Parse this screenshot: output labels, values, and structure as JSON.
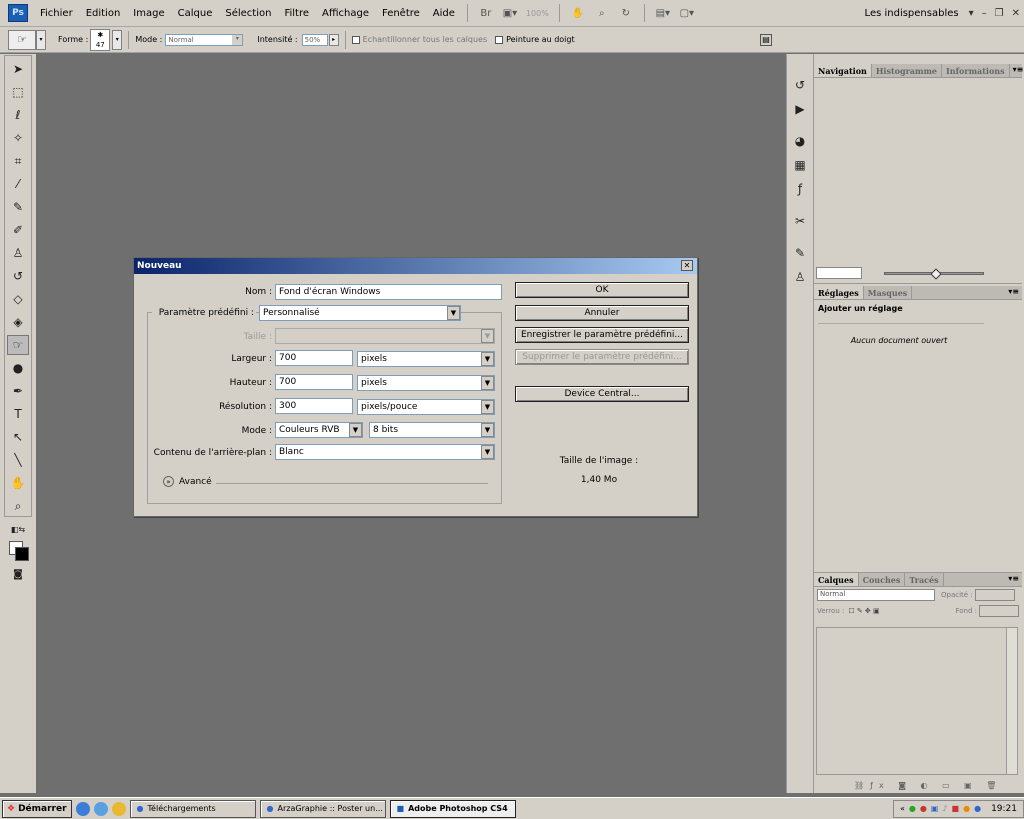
{
  "menubar": {
    "logo": "Ps",
    "items": [
      "Fichier",
      "Edition",
      "Image",
      "Calque",
      "Sélection",
      "Filtre",
      "Affichage",
      "Fenêtre",
      "Aide"
    ],
    "zoom": "100%",
    "workspace": "Les indispensables"
  },
  "options": {
    "forme_label": "Forme :",
    "brush_size": "47",
    "mode_label": "Mode :",
    "mode_value": "Normal",
    "intensite_label": "Intensité :",
    "intensite_value": "50%",
    "sample_all_label": "Echantillonner tous les calques",
    "finger_paint_label": "Peinture au doigt"
  },
  "panels": {
    "nav_tabs": [
      "Navigation",
      "Histogramme",
      "Informations"
    ],
    "adj_tabs": [
      "Réglages",
      "Masques"
    ],
    "adj_title": "Ajouter un réglage",
    "adj_empty": "Aucun document ouvert",
    "layer_tabs": [
      "Calques",
      "Couches",
      "Tracés"
    ],
    "blend_mode": "Normal",
    "opacity_label": "Opacité :",
    "lock_label": "Verrou :",
    "fill_label": "Fond :"
  },
  "dialog": {
    "title": "Nouveau",
    "nom_label": "Nom :",
    "nom_value": "Fond d'écran Windows",
    "preset_label": "Paramètre prédéfini :",
    "preset_value": "Personnalisé",
    "taille_label": "Taille :",
    "largeur_label": "Largeur :",
    "largeur_value": "700",
    "largeur_unit": "pixels",
    "hauteur_label": "Hauteur :",
    "hauteur_value": "700",
    "hauteur_unit": "pixels",
    "resolution_label": "Résolution :",
    "resolution_value": "300",
    "resolution_unit": "pixels/pouce",
    "mode_label": "Mode :",
    "mode_value": "Couleurs RVB",
    "depth_value": "8 bits",
    "bg_label": "Contenu de l'arrière-plan :",
    "bg_value": "Blanc",
    "advanced_label": "Avancé",
    "ok": "OK",
    "cancel": "Annuler",
    "save_preset": "Enregistrer le paramètre prédéfini...",
    "delete_preset": "Supprimer le paramètre prédéfini...",
    "device_central": "Device Central...",
    "image_size_label": "Taille de l'image :",
    "image_size_value": "1,40 Mo"
  },
  "taskbar": {
    "start": "Démarrer",
    "tasks": [
      "Téléchargements",
      "ArzaGraphie :: Poster un...",
      "Adobe Photoshop CS4"
    ],
    "clock": "19:21"
  }
}
